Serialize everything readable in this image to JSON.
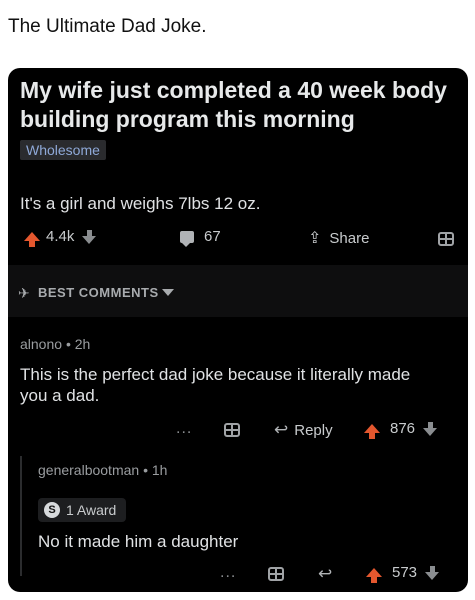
{
  "caption": "The Ultimate Dad Joke.",
  "post": {
    "title": "My wife just completed a 40 week body building program this morning",
    "flair": "Wholesome",
    "body": "It's a girl and weighs 7lbs 12 oz.",
    "upvotes": "4.4k",
    "comments": "67",
    "share_label": "Share"
  },
  "sort": {
    "label": "BEST COMMENTS"
  },
  "comments": [
    {
      "author": "alnono",
      "age": "2h",
      "body": "This is the perfect dad joke because it literally made you a dad.",
      "reply_label": "Reply",
      "score": "876",
      "more": "..."
    },
    {
      "author": "generalbootman",
      "age": "1h",
      "award": "1 Award",
      "award_icon_letter": "S",
      "body": "No it made him a daughter",
      "score": "573",
      "more": "..."
    }
  ],
  "colors": {
    "upvote": "#e4572e",
    "background": "#000000",
    "flair_text": "#8fa9d8"
  },
  "icons": [
    "upvote-icon",
    "downvote-icon",
    "comment-icon",
    "share-icon",
    "gift-icon",
    "rocket-icon",
    "reply-icon",
    "award-icon"
  ]
}
